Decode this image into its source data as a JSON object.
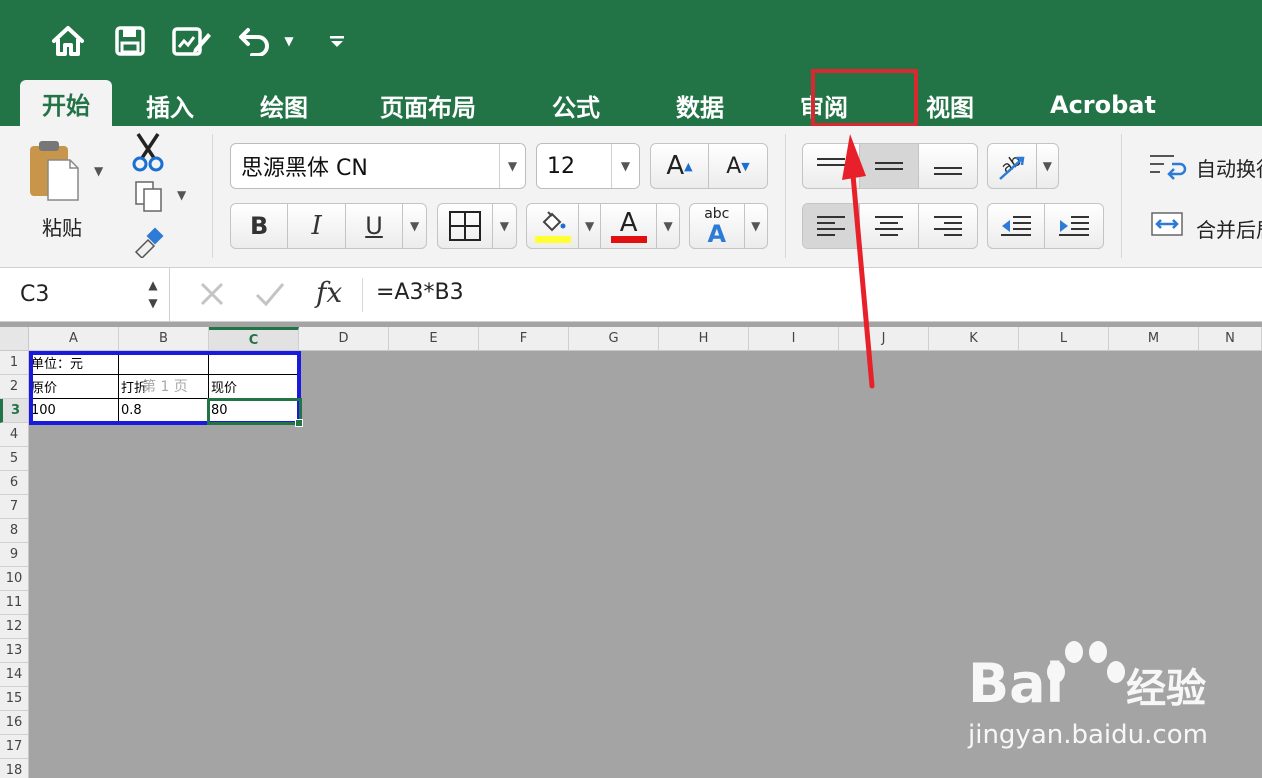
{
  "ribbon_tabs": [
    "开始",
    "插入",
    "绘图",
    "页面布局",
    "公式",
    "数据",
    "审阅",
    "视图",
    "Acrobat"
  ],
  "active_tab": "开始",
  "highlighted_tab": "视图",
  "clipboard": {
    "paste_label": "粘贴"
  },
  "font": {
    "name": "思源黑体 CN",
    "size": "12"
  },
  "format_buttons": {
    "bold": "B",
    "italic": "I",
    "underline": "U",
    "text_effect": "abc"
  },
  "alignment": {
    "wrap_text_label": "自动换行",
    "merge_label": "合并后居中"
  },
  "formula_bar": {
    "cell_ref": "C3",
    "fx_label": "fx",
    "formula": "=A3*B3"
  },
  "columns": [
    "A",
    "B",
    "C",
    "D",
    "E",
    "F",
    "G",
    "H",
    "I",
    "J",
    "K",
    "L",
    "M",
    "N"
  ],
  "selected_column": "C",
  "rows": [
    "1",
    "2",
    "3",
    "4",
    "5",
    "6",
    "7",
    "8",
    "9",
    "10",
    "11",
    "12",
    "13",
    "14",
    "15",
    "16",
    "17",
    "18"
  ],
  "selected_row": "3",
  "cells": {
    "A1": "单位：元",
    "B1": "",
    "C1": "",
    "A2": "原价",
    "B2": "打折",
    "C2": "现价",
    "A3": "100",
    "B3": "0.8",
    "C3": "80"
  },
  "page_break_label": "第 1 页",
  "watermark": {
    "brand_left": "Bai",
    "brand_right": "经验",
    "url": "jingyan.baidu.com"
  },
  "colors": {
    "excel_green": "#227447",
    "highlight_red": "#d9282f",
    "print_area_blue": "#1a1adf",
    "arrow_red": "#e8202a"
  }
}
